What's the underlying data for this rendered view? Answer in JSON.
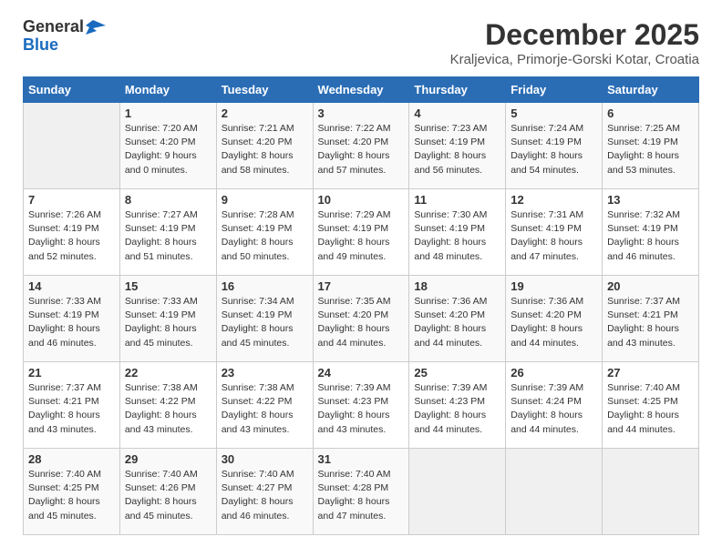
{
  "header": {
    "logo_general": "General",
    "logo_blue": "Blue",
    "month_title": "December 2025",
    "location": "Kraljevica, Primorje-Gorski Kotar, Croatia"
  },
  "days_of_week": [
    "Sunday",
    "Monday",
    "Tuesday",
    "Wednesday",
    "Thursday",
    "Friday",
    "Saturday"
  ],
  "weeks": [
    [
      {
        "day": "",
        "sunrise": "",
        "sunset": "",
        "daylight": ""
      },
      {
        "day": "1",
        "sunrise": "7:20 AM",
        "sunset": "4:20 PM",
        "hours": "9 hours and 0 minutes."
      },
      {
        "day": "2",
        "sunrise": "7:21 AM",
        "sunset": "4:20 PM",
        "hours": "8 hours and 58 minutes."
      },
      {
        "day": "3",
        "sunrise": "7:22 AM",
        "sunset": "4:20 PM",
        "hours": "8 hours and 57 minutes."
      },
      {
        "day": "4",
        "sunrise": "7:23 AM",
        "sunset": "4:19 PM",
        "hours": "8 hours and 56 minutes."
      },
      {
        "day": "5",
        "sunrise": "7:24 AM",
        "sunset": "4:19 PM",
        "hours": "8 hours and 54 minutes."
      },
      {
        "day": "6",
        "sunrise": "7:25 AM",
        "sunset": "4:19 PM",
        "hours": "8 hours and 53 minutes."
      }
    ],
    [
      {
        "day": "7",
        "sunrise": "7:26 AM",
        "sunset": "4:19 PM",
        "hours": "8 hours and 52 minutes."
      },
      {
        "day": "8",
        "sunrise": "7:27 AM",
        "sunset": "4:19 PM",
        "hours": "8 hours and 51 minutes."
      },
      {
        "day": "9",
        "sunrise": "7:28 AM",
        "sunset": "4:19 PM",
        "hours": "8 hours and 50 minutes."
      },
      {
        "day": "10",
        "sunrise": "7:29 AM",
        "sunset": "4:19 PM",
        "hours": "8 hours and 49 minutes."
      },
      {
        "day": "11",
        "sunrise": "7:30 AM",
        "sunset": "4:19 PM",
        "hours": "8 hours and 48 minutes."
      },
      {
        "day": "12",
        "sunrise": "7:31 AM",
        "sunset": "4:19 PM",
        "hours": "8 hours and 47 minutes."
      },
      {
        "day": "13",
        "sunrise": "7:32 AM",
        "sunset": "4:19 PM",
        "hours": "8 hours and 46 minutes."
      }
    ],
    [
      {
        "day": "14",
        "sunrise": "7:33 AM",
        "sunset": "4:19 PM",
        "hours": "8 hours and 46 minutes."
      },
      {
        "day": "15",
        "sunrise": "7:33 AM",
        "sunset": "4:19 PM",
        "hours": "8 hours and 45 minutes."
      },
      {
        "day": "16",
        "sunrise": "7:34 AM",
        "sunset": "4:19 PM",
        "hours": "8 hours and 45 minutes."
      },
      {
        "day": "17",
        "sunrise": "7:35 AM",
        "sunset": "4:20 PM",
        "hours": "8 hours and 44 minutes."
      },
      {
        "day": "18",
        "sunrise": "7:36 AM",
        "sunset": "4:20 PM",
        "hours": "8 hours and 44 minutes."
      },
      {
        "day": "19",
        "sunrise": "7:36 AM",
        "sunset": "4:20 PM",
        "hours": "8 hours and 44 minutes."
      },
      {
        "day": "20",
        "sunrise": "7:37 AM",
        "sunset": "4:21 PM",
        "hours": "8 hours and 43 minutes."
      }
    ],
    [
      {
        "day": "21",
        "sunrise": "7:37 AM",
        "sunset": "4:21 PM",
        "hours": "8 hours and 43 minutes."
      },
      {
        "day": "22",
        "sunrise": "7:38 AM",
        "sunset": "4:22 PM",
        "hours": "8 hours and 43 minutes."
      },
      {
        "day": "23",
        "sunrise": "7:38 AM",
        "sunset": "4:22 PM",
        "hours": "8 hours and 43 minutes."
      },
      {
        "day": "24",
        "sunrise": "7:39 AM",
        "sunset": "4:23 PM",
        "hours": "8 hours and 43 minutes."
      },
      {
        "day": "25",
        "sunrise": "7:39 AM",
        "sunset": "4:23 PM",
        "hours": "8 hours and 44 minutes."
      },
      {
        "day": "26",
        "sunrise": "7:39 AM",
        "sunset": "4:24 PM",
        "hours": "8 hours and 44 minutes."
      },
      {
        "day": "27",
        "sunrise": "7:40 AM",
        "sunset": "4:25 PM",
        "hours": "8 hours and 44 minutes."
      }
    ],
    [
      {
        "day": "28",
        "sunrise": "7:40 AM",
        "sunset": "4:25 PM",
        "hours": "8 hours and 45 minutes."
      },
      {
        "day": "29",
        "sunrise": "7:40 AM",
        "sunset": "4:26 PM",
        "hours": "8 hours and 45 minutes."
      },
      {
        "day": "30",
        "sunrise": "7:40 AM",
        "sunset": "4:27 PM",
        "hours": "8 hours and 46 minutes."
      },
      {
        "day": "31",
        "sunrise": "7:40 AM",
        "sunset": "4:28 PM",
        "hours": "8 hours and 47 minutes."
      },
      {
        "day": "",
        "sunrise": "",
        "sunset": "",
        "hours": ""
      },
      {
        "day": "",
        "sunrise": "",
        "sunset": "",
        "hours": ""
      },
      {
        "day": "",
        "sunrise": "",
        "sunset": "",
        "hours": ""
      }
    ]
  ]
}
